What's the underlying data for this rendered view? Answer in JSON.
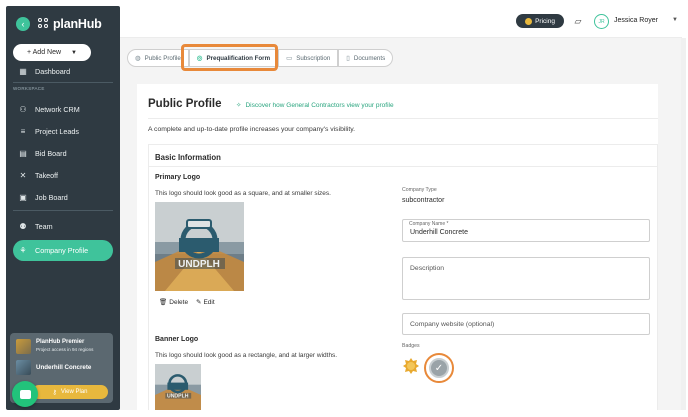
{
  "sidebar": {
    "brand": "planHub",
    "add_new": "+ Add New",
    "dashboard": "Dashboard",
    "section": "WORKSPACE",
    "items": [
      {
        "label": "Network CRM",
        "icon": "network-icon"
      },
      {
        "label": "Project Leads",
        "icon": "filter-icon"
      },
      {
        "label": "Bid Board",
        "icon": "clipboard-icon"
      },
      {
        "label": "Takeoff",
        "icon": "ruler-icon"
      },
      {
        "label": "Job Board",
        "icon": "folder-icon"
      }
    ],
    "team": "Team",
    "company_profile": "Company Profile",
    "premier": {
      "title": "PlanHub Premier",
      "desc": "Project access in 94 regions",
      "company": "Underhill Concrete",
      "view_plan": "View Plan"
    }
  },
  "topbar": {
    "pricing": "Pricing",
    "avatar_initials": "JR",
    "user_name": "Jessica Royer"
  },
  "tabs": [
    {
      "label": "Public Profile",
      "icon": "globe-icon"
    },
    {
      "label": "Prequalification Form",
      "icon": "check-circle-icon"
    },
    {
      "label": "Subscription",
      "icon": "card-icon"
    },
    {
      "label": "Documents",
      "icon": "document-icon"
    }
  ],
  "active_tab": "Prequalification Form",
  "page": {
    "title": "Public Profile",
    "discover_link": "Discover how General Contractors view your profile",
    "subtitle": "A complete and up-to-date profile increases your company's visibility."
  },
  "basic_info": {
    "title": "Basic Information",
    "primary_logo": {
      "label": "Primary Logo",
      "hint": "This logo should look good as a square, and at smaller sizes.",
      "delete": "Delete",
      "edit": "Edit",
      "image_text": "UNDPLH"
    },
    "banner_logo": {
      "label": "Banner Logo",
      "hint": "This logo should look good as a rectangle, and at larger widths."
    },
    "company_type_label": "Company Type",
    "company_type": "subcontractor",
    "company_name_label": "Company Name *",
    "company_name": "Underhill Concrete",
    "description_placeholder": "Description",
    "website_placeholder": "Company website (optional)",
    "badges_label": "Badges"
  },
  "colors": {
    "accent": "#3fc39b",
    "sidebar": "#2f3a42",
    "highlight": "#e8893a",
    "gold": "#e8b83d"
  }
}
